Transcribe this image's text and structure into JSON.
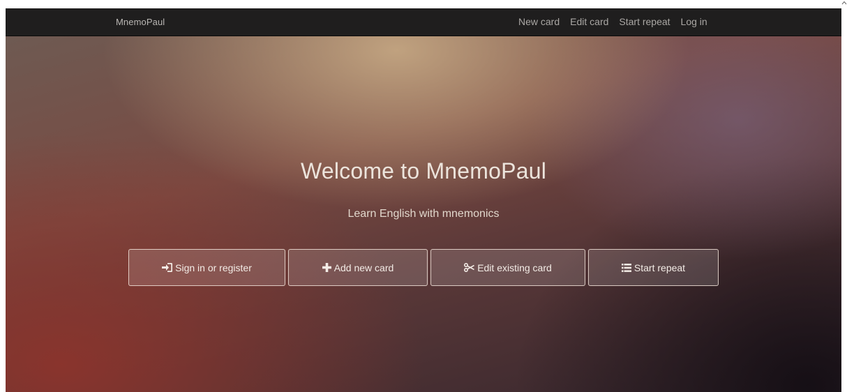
{
  "navbar": {
    "brand": "MnemoPaul",
    "links": [
      {
        "label": "New card"
      },
      {
        "label": "Edit card"
      },
      {
        "label": "Start repeat"
      },
      {
        "label": "Log in"
      }
    ]
  },
  "hero": {
    "title": "Welcome to MnemoPaul",
    "subtitle": "Learn English with mnemonics",
    "buttons": [
      {
        "label": "Sign in or register",
        "icon": "sign-in-icon"
      },
      {
        "label": "Add new card",
        "icon": "plus-icon"
      },
      {
        "label": "Edit existing card",
        "icon": "scissors-icon"
      },
      {
        "label": "Start repeat",
        "icon": "list-icon"
      }
    ]
  },
  "colors": {
    "navbar_bg": "#1f1e1e",
    "button_border": "#f0e1d7",
    "text_light": "#ece4dc"
  }
}
